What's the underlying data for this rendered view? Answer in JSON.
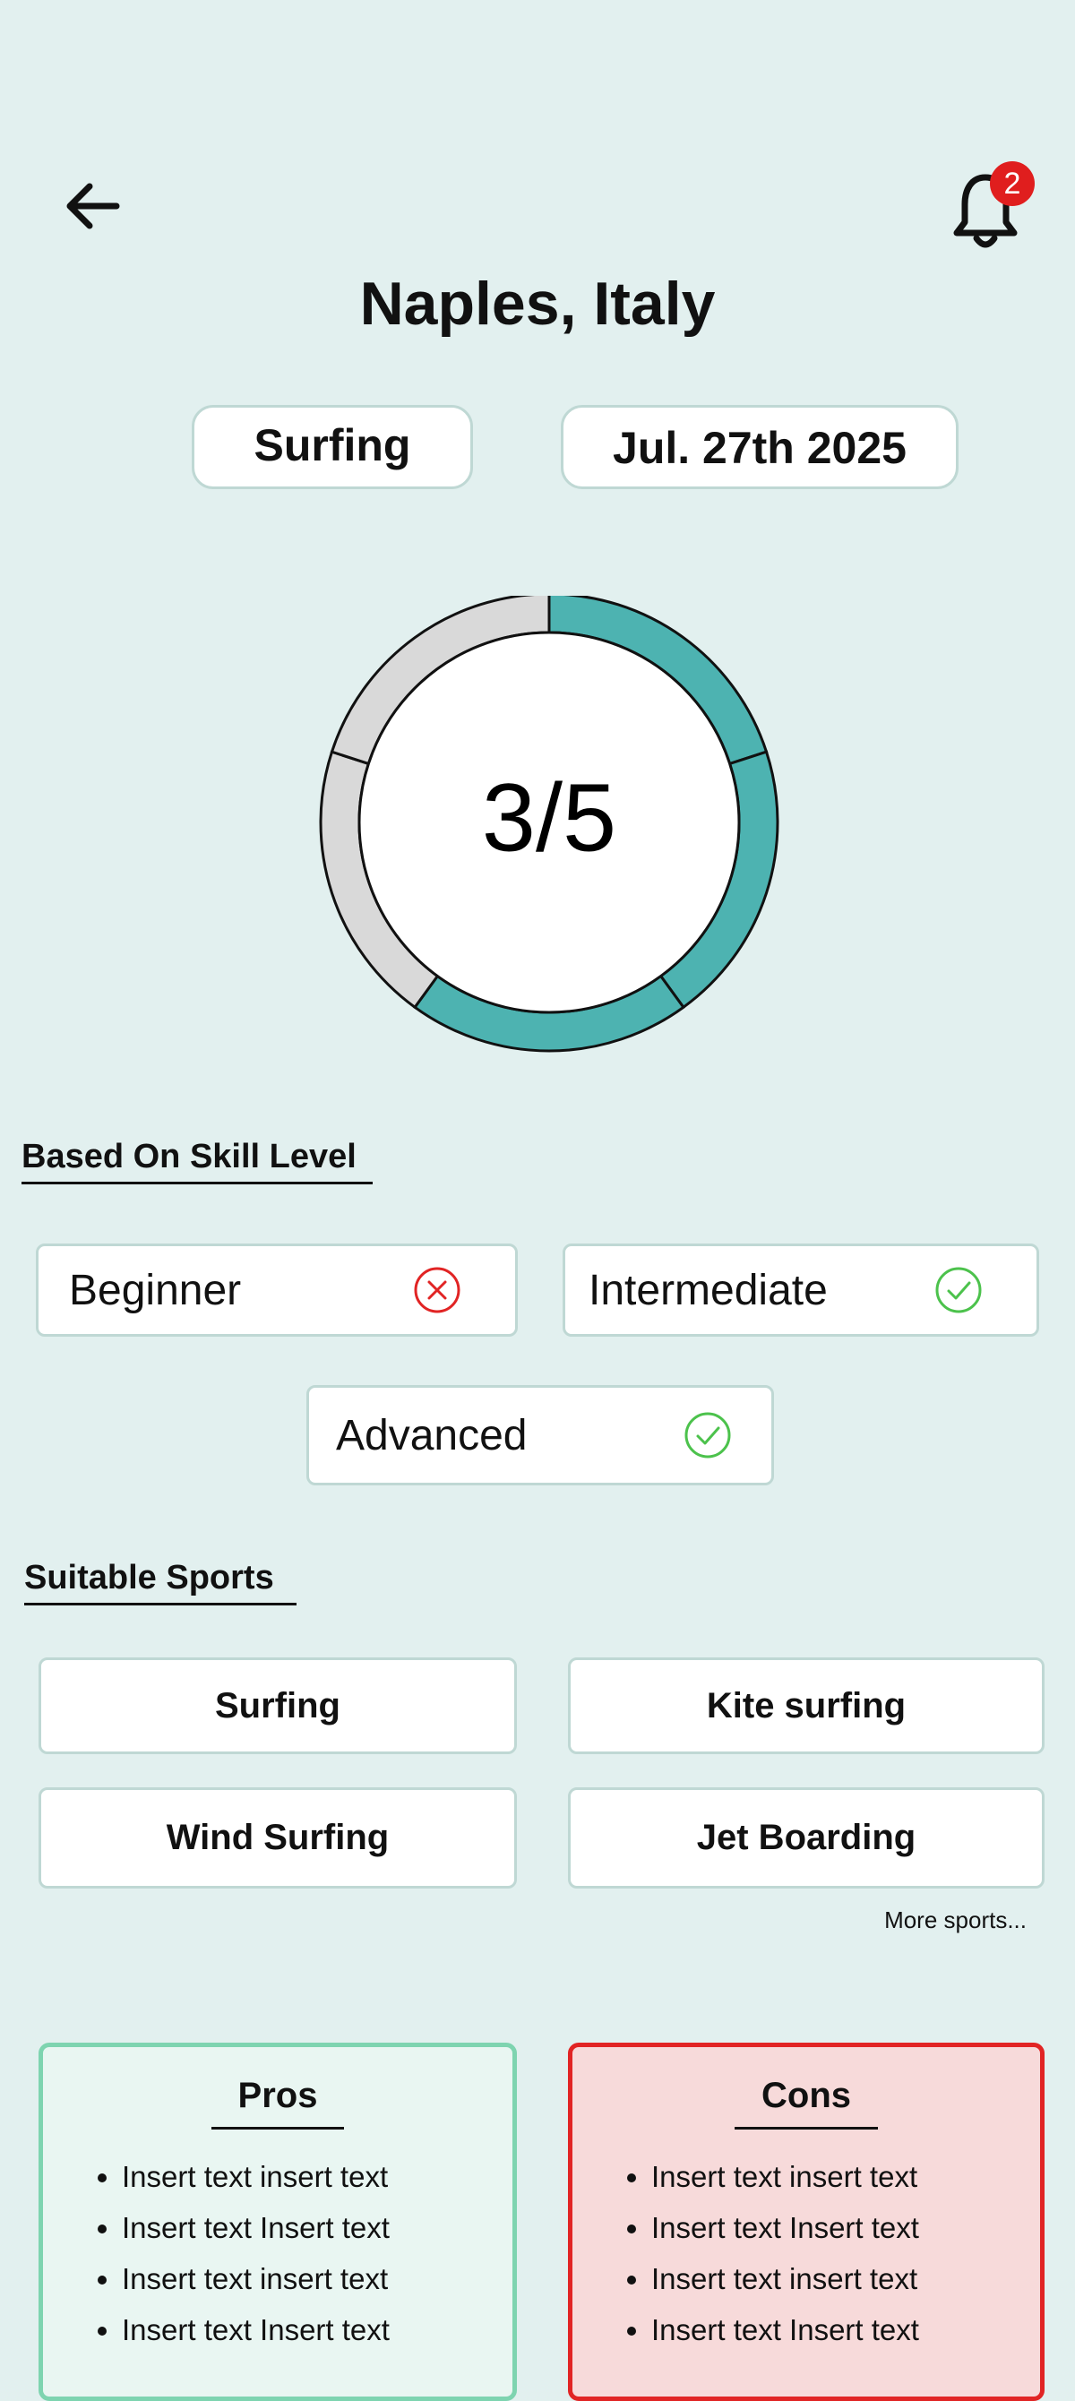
{
  "header": {
    "notification_count": "2",
    "location": "Naples, Italy"
  },
  "selection": {
    "sport": "Surfing",
    "date": "Jul. 27th 2025"
  },
  "score": {
    "label": "3/5",
    "value": 3,
    "max": 5,
    "filled_color": "#4DB3B1",
    "empty_color": "#D9D9D9"
  },
  "skill_section": {
    "title": "Based On Skill Level",
    "items": [
      {
        "label": "Beginner",
        "suitable": false
      },
      {
        "label": "Intermediate",
        "suitable": true
      },
      {
        "label": "Advanced",
        "suitable": true
      }
    ]
  },
  "sports_section": {
    "title": "Suitable Sports",
    "items": [
      "Surfing",
      "Kite surfing",
      "Wind Surfing",
      "Jet Boarding"
    ],
    "more_label": "More sports..."
  },
  "pros": {
    "title": "Pros",
    "items": [
      "Insert text insert text",
      "Insert text Insert text",
      "Insert text insert text",
      "Insert text Insert text"
    ]
  },
  "cons": {
    "title": "Cons",
    "items": [
      "Insert text insert text",
      "Insert text Insert text",
      "Insert text insert text",
      "Insert text Insert text"
    ]
  },
  "colors": {
    "background": "#E2F0EF",
    "accent": "#4DB3B1",
    "check": "#4CC24C",
    "cross": "#E12424",
    "pros_border": "#7ED4B0",
    "cons_border": "#E12424"
  }
}
